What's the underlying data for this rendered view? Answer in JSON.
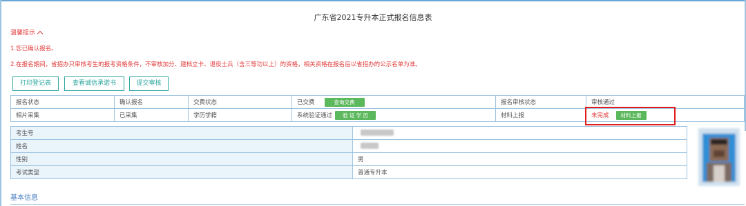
{
  "title": "广东省2021专升本正式报名信息表",
  "notice": {
    "toggle_label": "温馨提示",
    "lines": [
      "1.您已确认报名。",
      "2.在报名期间，省招办只审核考生的报考资格条件，不审核加分、建档立卡、退役士兵（含三等功以上）的资格，相关资格在报名后以省招办的公示名单为准。"
    ]
  },
  "toolbar": {
    "print_label": "打印登记表",
    "integrity_label": "查看诚信承诺书",
    "submit_label": "提交审核"
  },
  "status_table": {
    "row1": {
      "c1": "报名状态",
      "c2": "确认报名",
      "c3": "交费状态",
      "c4": "已交费",
      "c4_btn": "查询交费",
      "c5": "报名审核状态",
      "c6": "审核通过"
    },
    "row2": {
      "c1": "相片采集",
      "c2": "已采集",
      "c3": "学历学籍",
      "c4": "系统验证通过",
      "c4_btn": "验 证 学 历",
      "c5": "材料上报",
      "c6": "未完成",
      "c6_btn": "材料上报"
    }
  },
  "info_table": {
    "rows": [
      {
        "label": "考生号",
        "value": ""
      },
      {
        "label": "姓名",
        "value": ""
      },
      {
        "label": "性别",
        "value": "男"
      },
      {
        "label": "考试类型",
        "value": "普通专升本"
      }
    ]
  },
  "section_label": "基本信息",
  "colors": {
    "accent": "#2fa7a0",
    "warning": "#e23a3a",
    "success": "#5cb85c",
    "border": "#9cc3e0",
    "link": "#4a7fc1"
  }
}
